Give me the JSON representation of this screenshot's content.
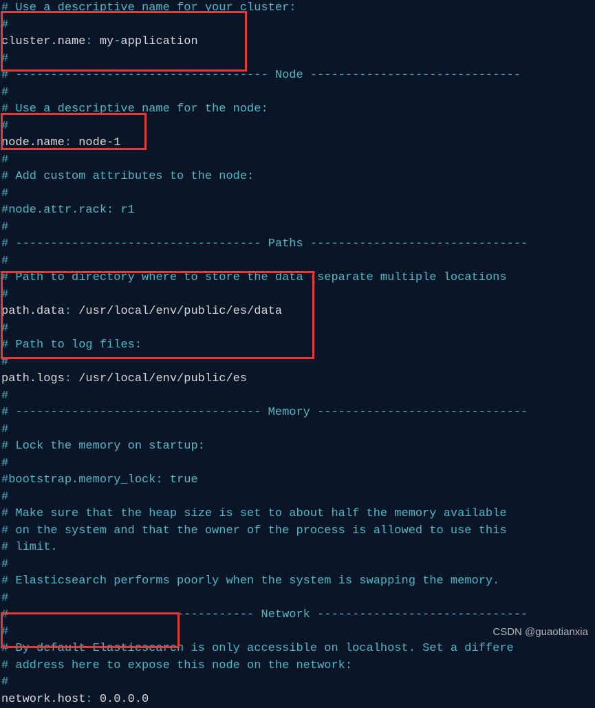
{
  "lines": [
    {
      "type": "comment",
      "text": "# Use a descriptive name for your cluster:"
    },
    {
      "type": "comment",
      "text": "#"
    },
    {
      "type": "kv",
      "key": "cluster.name",
      "sep": ": ",
      "value": "my-application"
    },
    {
      "type": "comment",
      "text": "#"
    },
    {
      "type": "comment",
      "text": "# ------------------------------------ Node ------------------------------"
    },
    {
      "type": "comment",
      "text": "#"
    },
    {
      "type": "comment",
      "text": "# Use a descriptive name for the node:"
    },
    {
      "type": "comment",
      "text": "#"
    },
    {
      "type": "kv",
      "key": "node.name",
      "sep": ": ",
      "value": "node-1"
    },
    {
      "type": "comment",
      "text": "#"
    },
    {
      "type": "comment",
      "text": "# Add custom attributes to the node:"
    },
    {
      "type": "comment",
      "text": "#"
    },
    {
      "type": "comment",
      "text": "#node.attr.rack: r1"
    },
    {
      "type": "comment",
      "text": "#"
    },
    {
      "type": "comment",
      "text": "# ----------------------------------- Paths -------------------------------"
    },
    {
      "type": "comment",
      "text": "#"
    },
    {
      "type": "comment",
      "text": "# Path to directory where to store the data (separate multiple locations "
    },
    {
      "type": "comment",
      "text": "#"
    },
    {
      "type": "kv",
      "key": "path.data",
      "sep": ": ",
      "value": "/usr/local/env/public/es/data"
    },
    {
      "type": "comment",
      "text": "#"
    },
    {
      "type": "comment",
      "text": "# Path to log files:"
    },
    {
      "type": "comment",
      "text": "#"
    },
    {
      "type": "kv",
      "key": "path.logs",
      "sep": ": ",
      "value": "/usr/local/env/public/es"
    },
    {
      "type": "comment",
      "text": "#"
    },
    {
      "type": "comment",
      "text": "# ----------------------------------- Memory ------------------------------"
    },
    {
      "type": "comment",
      "text": "#"
    },
    {
      "type": "comment",
      "text": "# Lock the memory on startup:"
    },
    {
      "type": "comment",
      "text": "#"
    },
    {
      "type": "comment",
      "text": "#bootstrap.memory_lock: true"
    },
    {
      "type": "comment",
      "text": "#"
    },
    {
      "type": "comment",
      "text": "# Make sure that the heap size is set to about half the memory available"
    },
    {
      "type": "comment",
      "text": "# on the system and that the owner of the process is allowed to use this"
    },
    {
      "type": "comment",
      "text": "# limit."
    },
    {
      "type": "comment",
      "text": "#"
    },
    {
      "type": "comment",
      "text": "# Elasticsearch performs poorly when the system is swapping the memory."
    },
    {
      "type": "comment",
      "text": "#"
    },
    {
      "type": "comment",
      "text": "# ---------------------------------- Network ------------------------------"
    },
    {
      "type": "comment",
      "text": "#"
    },
    {
      "type": "comment",
      "text": "# By default Elasticsearch is only accessible on localhost. Set a differe"
    },
    {
      "type": "comment",
      "text": "# address here to expose this node on the network:"
    },
    {
      "type": "comment",
      "text": "#"
    },
    {
      "type": "kv",
      "key": "network.host",
      "sep": ": ",
      "value": "0.0.0.0"
    }
  ],
  "watermark": "CSDN @guaotianxia"
}
